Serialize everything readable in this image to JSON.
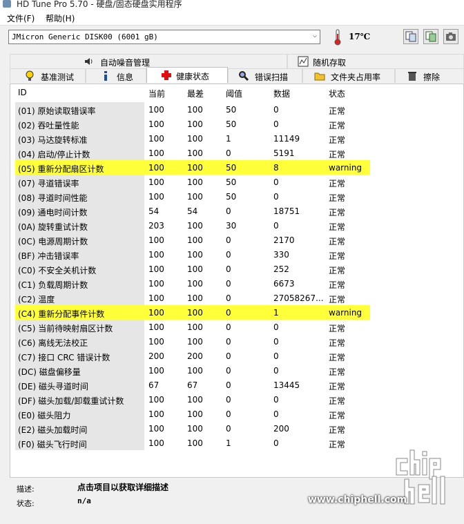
{
  "window": {
    "title": "HD Tune Pro 5.70 - 硬盘/固态硬盘实用程序"
  },
  "menu": [
    {
      "label": "文件(F)"
    },
    {
      "label": "帮助(H)"
    }
  ],
  "toolbar": {
    "drive": "JMicron Generic DISK00 (6001 gB)",
    "temperature": "17℃"
  },
  "tabs_row1": [
    {
      "label": "自动噪音管理",
      "icon": "speaker-icon"
    },
    {
      "label": "随机存取",
      "icon": "random-access-icon"
    }
  ],
  "tabs_row2": [
    {
      "label": "基准测试",
      "icon": "lightbulb-icon"
    },
    {
      "label": "信息",
      "icon": "info-icon"
    },
    {
      "label": "健康状态",
      "icon": "red-cross-icon",
      "active": true
    },
    {
      "label": "错误扫描",
      "icon": "magnifier-icon"
    },
    {
      "label": "文件夹占用率",
      "icon": "folder-icon"
    },
    {
      "label": "擦除",
      "icon": "trash-icon"
    }
  ],
  "table": {
    "columns": [
      "ID",
      "当前",
      "最差",
      "阈值",
      "数据",
      "状态"
    ],
    "rows": [
      [
        "(01) 原始读取错误率",
        "100",
        "100",
        "50",
        "0",
        "正常"
      ],
      [
        "(02) 吞吐量性能",
        "100",
        "100",
        "50",
        "0",
        "正常"
      ],
      [
        "(03) 马达旋转标准",
        "100",
        "100",
        "1",
        "11149",
        "正常"
      ],
      [
        "(04) 启动/停止计数",
        "100",
        "100",
        "0",
        "5191",
        "正常"
      ],
      [
        "(05) 重新分配扇区计数",
        "100",
        "100",
        "50",
        "8",
        "warning"
      ],
      [
        "(07) 寻道错误率",
        "100",
        "100",
        "50",
        "0",
        "正常"
      ],
      [
        "(08) 寻道时间性能",
        "100",
        "100",
        "50",
        "0",
        "正常"
      ],
      [
        "(09) 通电时间计数",
        "54",
        "54",
        "0",
        "18751",
        "正常"
      ],
      [
        "(0A) 旋转重试计数",
        "203",
        "100",
        "30",
        "0",
        "正常"
      ],
      [
        "(0C) 电源周期计数",
        "100",
        "100",
        "0",
        "2170",
        "正常"
      ],
      [
        "(BF) 冲击错误率",
        "100",
        "100",
        "0",
        "330",
        "正常"
      ],
      [
        "(C0) 不安全关机计数",
        "100",
        "100",
        "0",
        "252",
        "正常"
      ],
      [
        "(C1) 负载周期计数",
        "100",
        "100",
        "0",
        "6673",
        "正常"
      ],
      [
        "(C2) 温度",
        "100",
        "100",
        "0",
        "27058267...",
        "正常"
      ],
      [
        "(C4) 重新分配事件计数",
        "100",
        "100",
        "0",
        "1",
        "warning"
      ],
      [
        "(C5) 当前待映射扇区计数",
        "100",
        "100",
        "0",
        "0",
        "正常"
      ],
      [
        "(C6) 离线无法校正",
        "100",
        "100",
        "0",
        "0",
        "正常"
      ],
      [
        "(C7) 接口 CRC 错误计数",
        "200",
        "200",
        "0",
        "0",
        "正常"
      ],
      [
        "(DC) 磁盘偏移量",
        "100",
        "100",
        "0",
        "0",
        "正常"
      ],
      [
        "(DE) 磁头寻道时间",
        "67",
        "67",
        "0",
        "13445",
        "正常"
      ],
      [
        "(DF) 磁头加载/卸载重试计数",
        "100",
        "100",
        "0",
        "0",
        "正常"
      ],
      [
        "(E0) 磁头阻力",
        "100",
        "100",
        "0",
        "0",
        "正常"
      ],
      [
        "(E2) 磁头加载时间",
        "100",
        "100",
        "0",
        "200",
        "正常"
      ],
      [
        "(F0) 磁头飞行时间",
        "100",
        "100",
        "1",
        "0",
        "正常"
      ]
    ]
  },
  "details": {
    "desc_label": "描述:",
    "desc_value": "点击项目以获取详细描述",
    "status_label": "状态:",
    "status_value": "n/a"
  },
  "watermark": {
    "text": "www.chiphell.com"
  },
  "colors": {
    "warning_highlight": "#ffff3a",
    "id_column_bg": "#e6e6e6"
  }
}
